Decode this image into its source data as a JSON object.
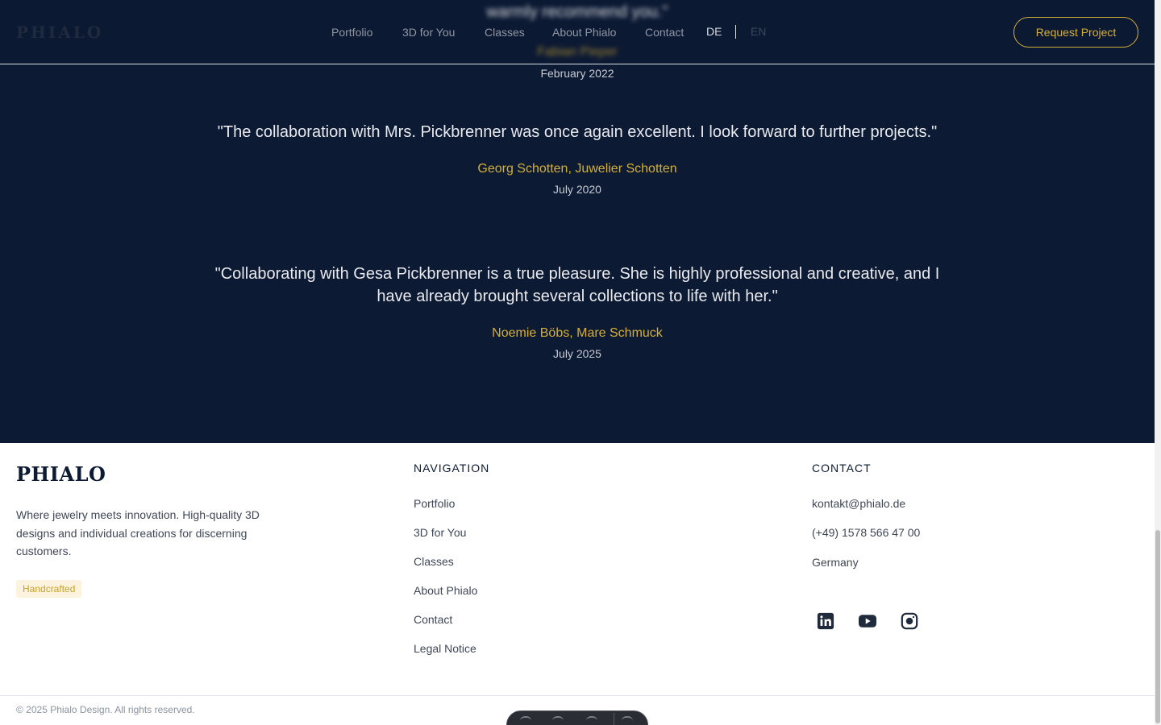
{
  "header": {
    "logo": "PHIALO",
    "nav": [
      {
        "label": "Portfolio"
      },
      {
        "label": "3D for You"
      },
      {
        "label": "Classes"
      },
      {
        "label": "About Phialo"
      },
      {
        "label": "Contact"
      }
    ],
    "lang_de": "DE",
    "lang_sep": "|",
    "lang_en": "EN",
    "cta": "Request Project"
  },
  "testimonials": {
    "previous": {
      "quote_tail": "warmly recommend you.\"",
      "author": "Fabian Pieper",
      "date": "February 2022"
    },
    "items": [
      {
        "quote": "\"The collaboration with Mrs. Pickbrenner was once again excellent. I look forward to further projects.\"",
        "author": "Georg Schotten, Juwelier Schotten",
        "date": "July 2020"
      },
      {
        "quote": "\"Collaborating with Gesa Pickbrenner is a true pleasure. She is highly professional and creative, and I have already brought several collections to life with her.\"",
        "author": "Noemie Böbs, Mare Schmuck",
        "date": "July 2025"
      }
    ]
  },
  "footer": {
    "logo": "PHIALO",
    "tagline": "Where jewelry meets innovation. High-quality 3D designs and individual creations for discerning customers.",
    "badge": "Handcrafted",
    "navigation": {
      "heading": "NAVIGATION",
      "links": [
        "Portfolio",
        "3D for You",
        "Classes",
        "About Phialo",
        "Contact",
        "Legal Notice"
      ]
    },
    "contact": {
      "heading": "CONTACT",
      "email": "kontakt@phialo.de",
      "phone": "(+49) 1578 566 47 00",
      "country": "Germany"
    },
    "socials": [
      {
        "icon": "linkedin-icon"
      },
      {
        "icon": "youtube-icon"
      },
      {
        "icon": "instagram-icon"
      }
    ],
    "copyright": "© 2025 Phialo Design. All rights reserved."
  },
  "colors": {
    "navy": "#0c1a33",
    "gold": "#d4af37",
    "text_light": "#e8eaee",
    "text_body": "#3f4756"
  }
}
